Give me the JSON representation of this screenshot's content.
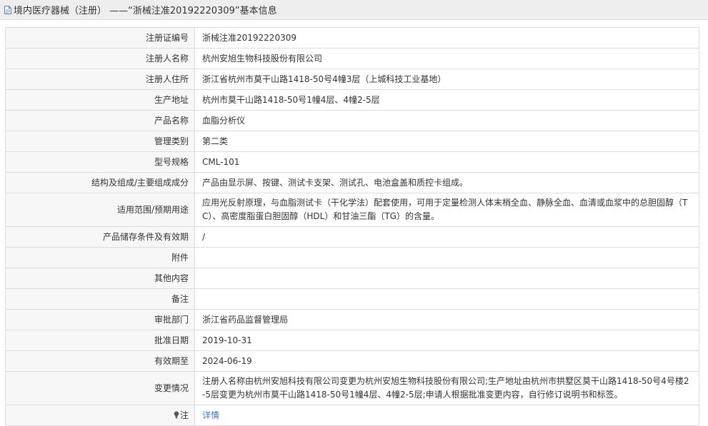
{
  "header": {
    "title": "境内医疗器械（注册） ——“浙械注准20192220309”基本信息",
    "icon": "document-icon"
  },
  "rows": [
    {
      "label": "注册证编号",
      "value": "浙械注准20192220309"
    },
    {
      "label": "注册人名称",
      "value": "杭州安旭生物科技股份有限公司"
    },
    {
      "label": "注册人住所",
      "value": "浙江省杭州市莫干山路1418-50号4幢3层（上城科技工业基地）"
    },
    {
      "label": "生产地址",
      "value": "杭州市莫干山路1418-50号1幢4层、4幢2-5层"
    },
    {
      "label": "产品名称",
      "value": "血脂分析仪"
    },
    {
      "label": "管理类别",
      "value": "第二类"
    },
    {
      "label": "型号规格",
      "value": "CML-101"
    },
    {
      "label": "结构及组成/主要组成成分",
      "value": "产品由显示屏、按键、测试卡支架、测试孔、电池盒盖和质控卡组成。"
    },
    {
      "label": "适用范围/预期用途",
      "value": "应用光反射原理，与血脂测试卡（干化学法）配套使用，可用于定量检测人体末梢全血、静脉全血、血清或血浆中的总胆固醇（TC）、高密度脂蛋白胆固醇（HDL）和甘油三酯（TG）的含量。"
    },
    {
      "label": "产品储存条件及有效期",
      "value": "/"
    },
    {
      "label": "附件",
      "value": ""
    },
    {
      "label": "其他内容",
      "value": ""
    },
    {
      "label": "备注",
      "value": ""
    },
    {
      "label": "审批部门",
      "value": "浙江省药品监督管理局"
    },
    {
      "label": "批准日期",
      "value": "2019-10-31"
    },
    {
      "label": "有效期至",
      "value": "2024-06-19"
    },
    {
      "label": "变更情况",
      "value": "注册人名称由杭州安旭科技有限公司变更为杭州安旭生物科技股份有限公司;生产地址由杭州市拱墅区莫干山路1418-50号4号楼2-5层变更为杭州市莫干山路1418-50号1幢4层、4幢2-5层;申请人根据批准变更内容，自行修订说明书和标签。"
    }
  ],
  "note": {
    "label": "注",
    "icon": "bulb-icon",
    "link_text": "详情"
  },
  "colors": {
    "link": "#3f72b8",
    "label_bg": "#f7f7f7",
    "border": "#dcdcdc",
    "header_bg": "#eeeeee"
  }
}
